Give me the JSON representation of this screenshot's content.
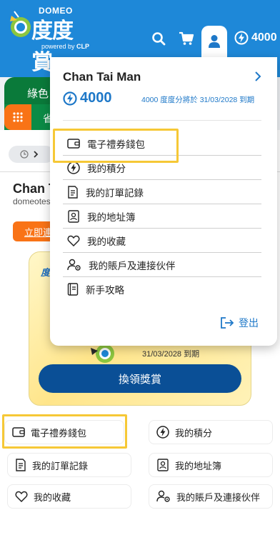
{
  "brand": {
    "name": "DOMEO",
    "title": "度度賞",
    "powered": "powered by",
    "powered_brand": "CLP"
  },
  "header": {
    "points": "4000"
  },
  "nav": {
    "green_label": "綠色",
    "tab_partial": "省"
  },
  "page": {
    "user_name_partial": "Chan T",
    "user_email_partial": "domeotes",
    "cta_partial": "立即連",
    "card_label": "度度",
    "card_date": "31/03/2028 到期",
    "redeem_button": "換領獎賞"
  },
  "grid": {
    "wallet": "電子禮券錢包",
    "points": "我的積分",
    "orders": "我的訂單記錄",
    "address": "我的地址簿",
    "favourites": "我的收藏",
    "account": "我的賬戶及連接伙伴"
  },
  "dropdown": {
    "name": "Chan Tai Man",
    "points": "4000",
    "expiry": "4000 度度分將於 31/03/2028 到期",
    "items": [
      {
        "label": "電子禮券錢包",
        "icon": "wallet-icon"
      },
      {
        "label": "我的積分",
        "icon": "bolt-icon"
      },
      {
        "label": "我的訂單記錄",
        "icon": "receipt-icon"
      },
      {
        "label": "我的地址簿",
        "icon": "address-book-icon"
      },
      {
        "label": "我的收藏",
        "icon": "heart-icon"
      },
      {
        "label": "我的賬戶及連接伙伴",
        "icon": "user-settings-icon"
      },
      {
        "label": "新手攻略",
        "icon": "guide-book-icon"
      }
    ],
    "logout": "登出"
  },
  "colors": {
    "header_blue": "#1e88d8",
    "accent_blue": "#1e78c8",
    "button_navy": "#0a4f96",
    "orange": "#f97316",
    "green": "#0a7a3a",
    "highlight_yellow": "#f6c836"
  }
}
